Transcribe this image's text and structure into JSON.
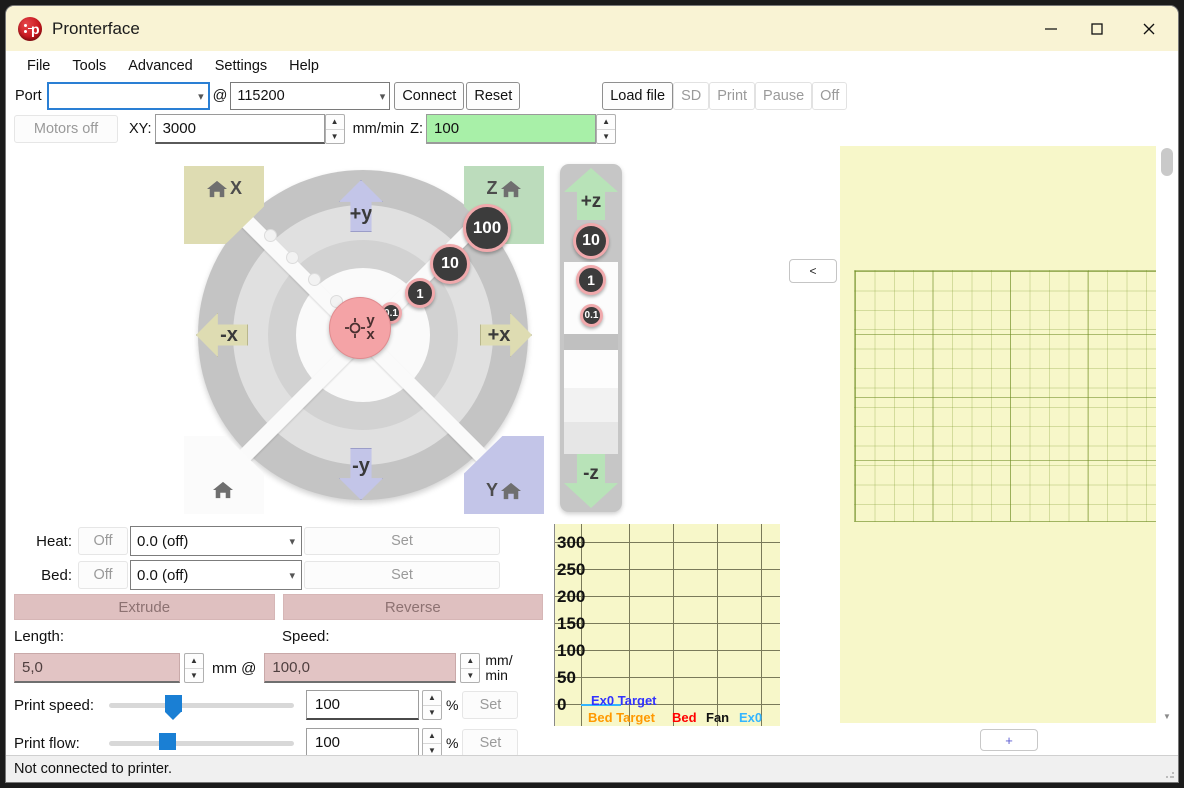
{
  "window": {
    "title": "Pronterface",
    "app_icon": "pronterface-logo-icon",
    "minimize_label": "—",
    "maximize_label": "□",
    "close_label": "✕"
  },
  "menubar": {
    "items": [
      {
        "label": "File"
      },
      {
        "label": "Tools"
      },
      {
        "label": "Advanced"
      },
      {
        "label": "Settings"
      },
      {
        "label": "Help"
      }
    ]
  },
  "toolbar": {
    "port_label": "Port",
    "port_value": "",
    "at_label": "@",
    "baud_value": "115200",
    "connect_label": "Connect",
    "reset_label": "Reset",
    "loadfile_label": "Load file",
    "sd_label": "SD",
    "print_label": "Print",
    "pause_label": "Pause",
    "off_label": "Off"
  },
  "jogbar": {
    "motors_off_label": "Motors off",
    "xy_label": "XY:",
    "xy_value": "3000",
    "units_label": "mm/min",
    "z_label": "Z:",
    "z_value": "100",
    "spin_up": "▲",
    "spin_down": "▼"
  },
  "collapse_button": {
    "label": "<"
  },
  "xy_jog": {
    "home_x_label": "X",
    "home_z_label": "Z",
    "home_y_label": "Y",
    "home_all_label": "",
    "plus_y": "+y",
    "minus_y": "-y",
    "plus_x": "+x",
    "minus_x": "-x",
    "center_label_y": "y",
    "center_label_x": "x",
    "steps": [
      "0.1",
      "1",
      "10",
      "100"
    ]
  },
  "z_jog": {
    "plus_z": "+z",
    "minus_z": "-z",
    "steps": [
      "10",
      "1",
      "0.1"
    ]
  },
  "heaters": {
    "heat_label": "Heat:",
    "heat_toggle": "Off",
    "heat_value": "0.0 (off)",
    "heat_set": "Set",
    "bed_label": "Bed:",
    "bed_toggle": "Off",
    "bed_value": "0.0 (off)",
    "bed_set": "Set"
  },
  "extruder": {
    "extrude_label": "Extrude",
    "reverse_label": "Reverse",
    "length_label": "Length:",
    "length_value": "5,0",
    "mm_at_label": "mm @",
    "speed_label": "Speed:",
    "speed_value": "100,0",
    "speed_units": "mm/\nmin",
    "speed_units_line1": "mm/",
    "speed_units_line2": "min"
  },
  "speed_sliders": [
    {
      "label": "Print speed:",
      "value": "100",
      "unit": "%",
      "set_label": "Set"
    },
    {
      "label": "Print flow:",
      "value": "100",
      "unit": "%",
      "set_label": "Set"
    }
  ],
  "statusbar": {
    "text": "Not connected to printer."
  },
  "gcode_view": {
    "zoom_plus_label": "+"
  },
  "chart_data": {
    "type": "line",
    "title": "",
    "xlabel": "",
    "ylabel": "",
    "ylim": [
      0,
      300
    ],
    "yticks": [
      "0",
      "50",
      "100",
      "150",
      "200",
      "250",
      "300"
    ],
    "grid": true,
    "legend_position": "bottom-left",
    "series": [
      {
        "name": "Ex0 Target",
        "color": "#3333ff",
        "values": [
          0,
          0
        ]
      },
      {
        "name": "Bed Target",
        "color": "#ff9900",
        "values": [
          0,
          0
        ]
      },
      {
        "name": "Bed",
        "color": "#ff0000",
        "values": [
          0,
          0
        ]
      },
      {
        "name": "Fan",
        "color": "#111111",
        "values": [
          0,
          0
        ]
      },
      {
        "name": "Ex0",
        "color": "#33b5ff",
        "values": [
          0,
          0
        ]
      }
    ]
  }
}
